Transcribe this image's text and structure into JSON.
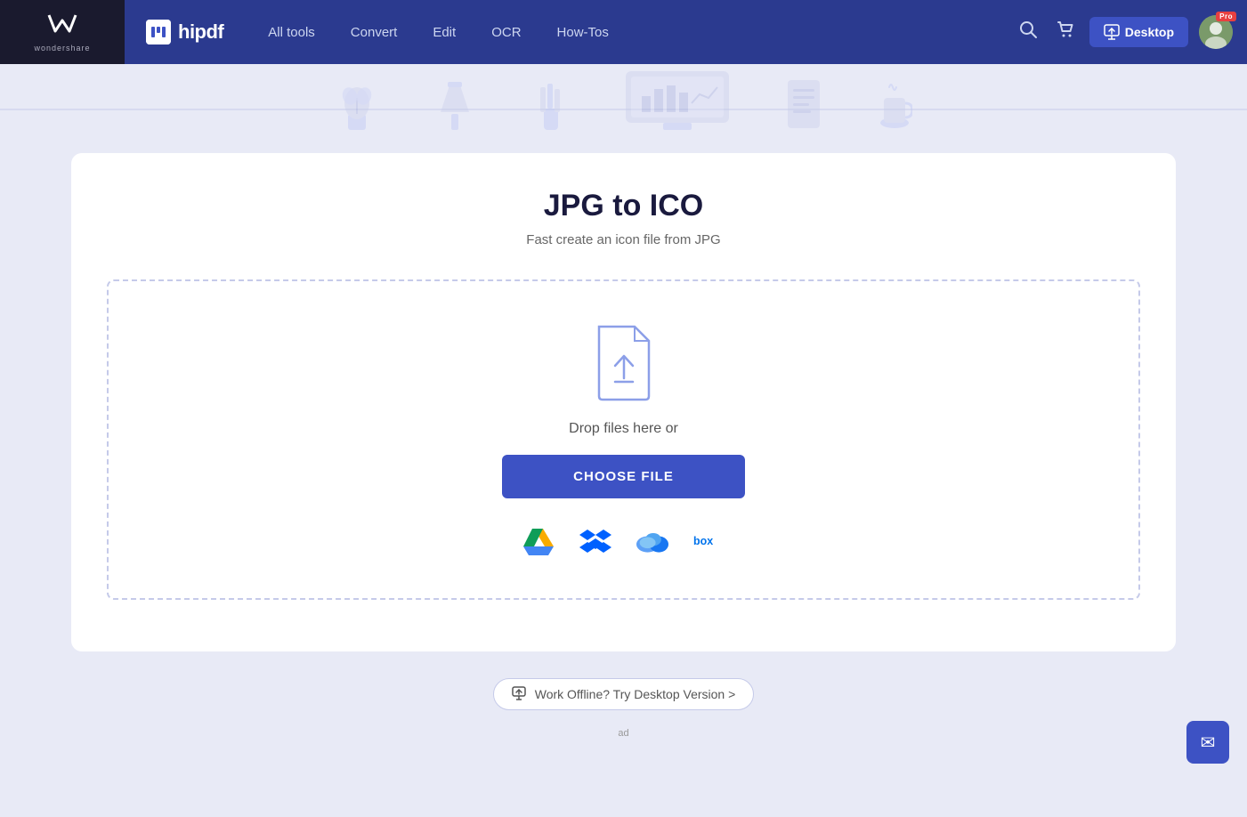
{
  "brand": {
    "wondershare_text": "wondershare",
    "hipdf_name": "hipdf",
    "hipdf_icon_letter": "h"
  },
  "nav": {
    "links": [
      {
        "id": "all-tools",
        "label": "All tools"
      },
      {
        "id": "convert",
        "label": "Convert"
      },
      {
        "id": "edit",
        "label": "Edit"
      },
      {
        "id": "ocr",
        "label": "OCR"
      },
      {
        "id": "how-tos",
        "label": "How-Tos"
      }
    ],
    "desktop_btn_label": "Desktop",
    "pro_badge": "Pro"
  },
  "page": {
    "title": "JPG to ICO",
    "subtitle": "Fast create an icon file from JPG"
  },
  "dropzone": {
    "drop_text": "Drop files here or",
    "choose_btn_label": "CHOOSE FILE"
  },
  "cloud_services": [
    {
      "id": "google-drive",
      "label": "Google Drive"
    },
    {
      "id": "dropbox",
      "label": "Dropbox"
    },
    {
      "id": "onedrive",
      "label": "OneDrive"
    },
    {
      "id": "box",
      "label": "Box"
    }
  ],
  "desktop_banner": {
    "text": "Work Offline? Try Desktop Version >"
  },
  "ad_label": "ad",
  "email_icon": "✉"
}
